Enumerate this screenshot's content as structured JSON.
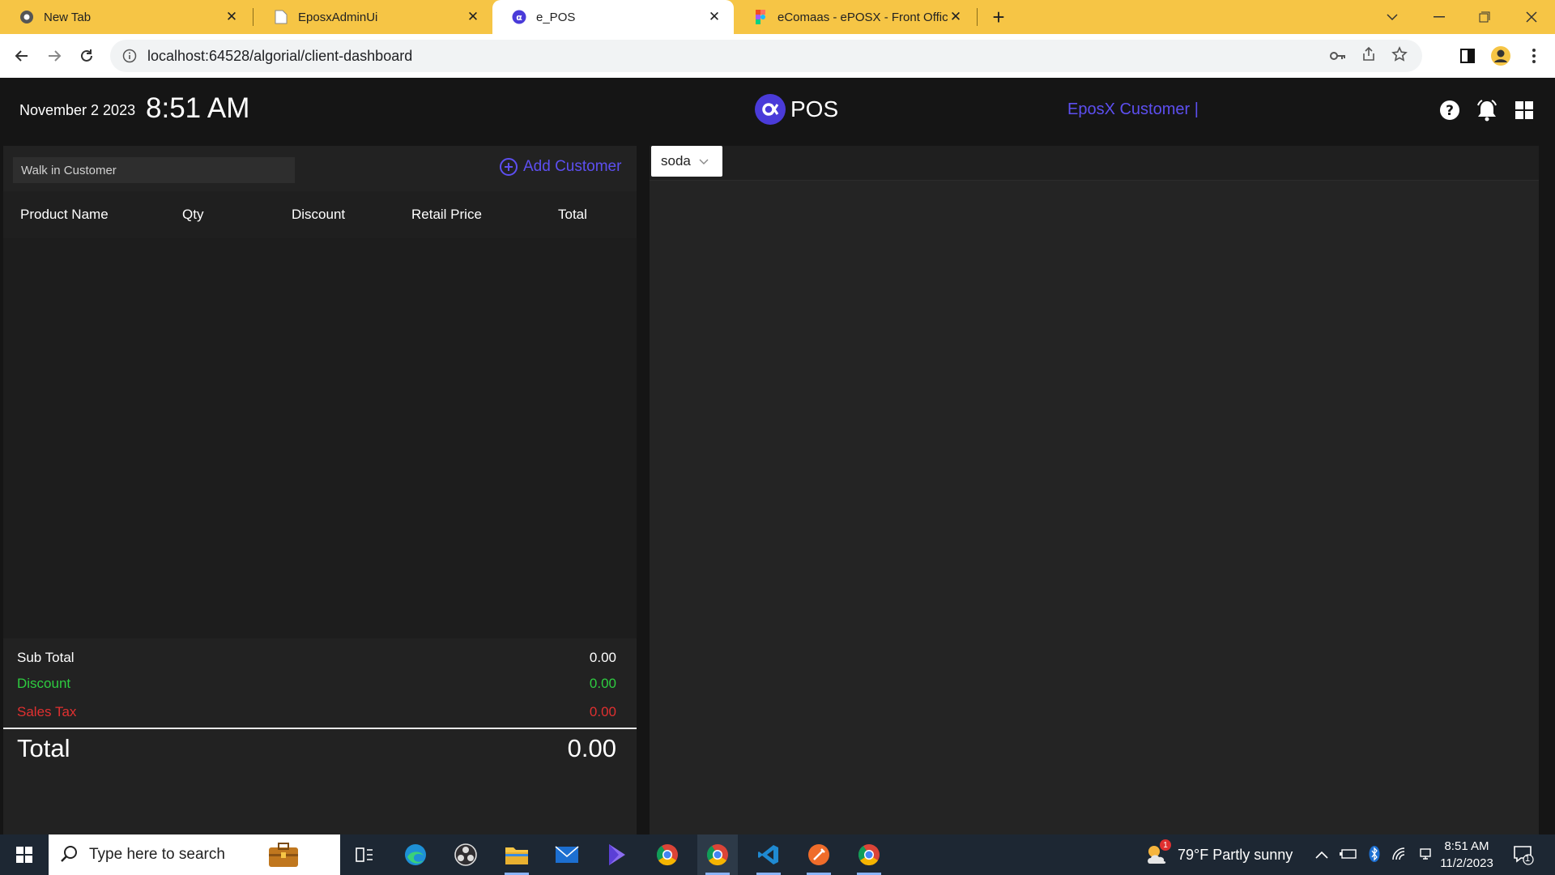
{
  "browser": {
    "tabs": [
      {
        "title": "New Tab",
        "close": "✕"
      },
      {
        "title": "EposxAdminUi",
        "close": "✕"
      },
      {
        "title": "e_POS",
        "close": "✕"
      },
      {
        "title": "eComaas - ePOSX - Front Office",
        "close": "✕"
      }
    ],
    "new_tab": "+",
    "url": "localhost:64528/algorial/client-dashboard"
  },
  "header": {
    "date": "November 2 2023",
    "time": "8:51 AM",
    "logo_text": "POS",
    "customer_link": "EposX Customer |"
  },
  "cart": {
    "customer_placeholder": "Walk in Customer",
    "add_customer": "Add Customer",
    "columns": [
      "Product Name",
      "Qty",
      "Discount",
      "Retail Price",
      "Total"
    ],
    "subtotal_label": "Sub Total",
    "subtotal_value": "0.00",
    "discount_label": "Discount",
    "discount_value": "0.00",
    "tax_label": "Sales Tax",
    "tax_value": "0.00",
    "total_label": "Total",
    "total_value": "0.00"
  },
  "products": {
    "category_selected": "soda"
  },
  "taskbar": {
    "search_placeholder": "Type here to search",
    "weather": "79°F  Partly sunny",
    "weather_badge": "1",
    "time": "8:51 AM",
    "date": "11/2/2023",
    "notification_count": "1"
  },
  "colors": {
    "accent": "#5d4ff0",
    "discount": "#2ecc40",
    "tax": "#e03030",
    "tab_bar": "#f6c545"
  }
}
